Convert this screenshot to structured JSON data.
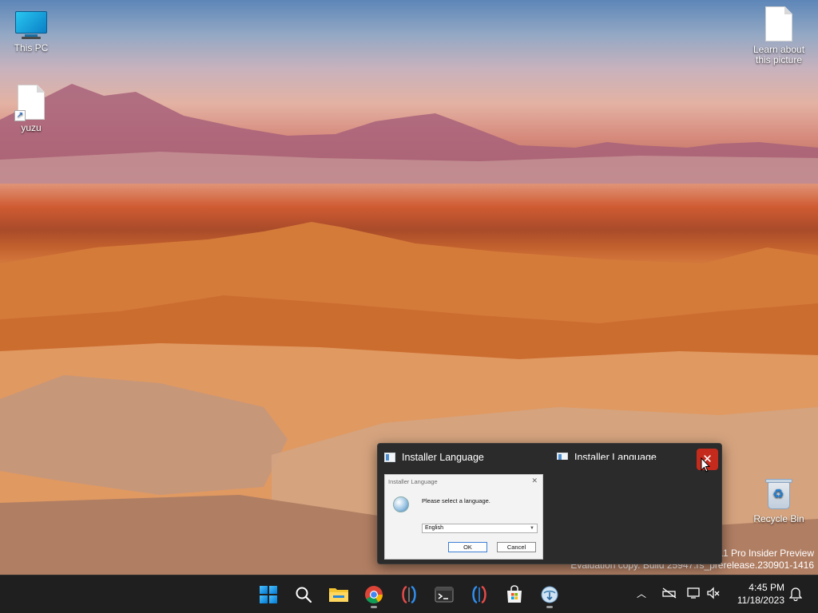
{
  "desktop": {
    "icons": [
      {
        "label": "This PC"
      },
      {
        "label": "yuzu"
      },
      {
        "label": "Learn about this picture"
      },
      {
        "label": "Recycle Bin"
      }
    ],
    "watermark": {
      "line1": "11 Pro Insider Preview",
      "line2": "Evaluation copy. Build 25947.rs_prerelease.230901-1416"
    }
  },
  "thumbnail_popup": {
    "left_title": "Installer Language",
    "right_title": "Installer Language",
    "close_glyph": "✕",
    "dialog_preview": {
      "title": "Installer Language",
      "prompt": "Please select a language.",
      "selected_language": "English",
      "ok_label": "OK",
      "cancel_label": "Cancel"
    }
  },
  "taskbar": {
    "apps": [
      {
        "name": "start-icon"
      },
      {
        "name": "search-icon"
      },
      {
        "name": "file-explorer-icon"
      },
      {
        "name": "chrome-icon"
      },
      {
        "name": "app-icon-red-blue"
      },
      {
        "name": "terminal-icon"
      },
      {
        "name": "app-icon-blue-red"
      },
      {
        "name": "microsoft-store-icon"
      },
      {
        "name": "installer-icon"
      }
    ],
    "tray": {
      "time": "4:45 PM",
      "date": "11/18/2023"
    }
  },
  "colors": {
    "accent": "#0078d4",
    "close_red": "#c42b1c",
    "taskbar_bg": "#1f1f1f"
  }
}
